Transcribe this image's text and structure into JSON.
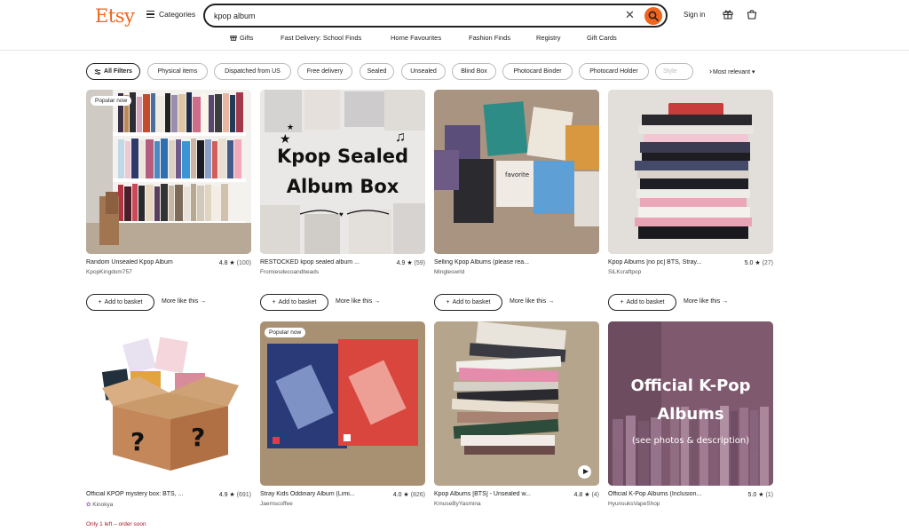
{
  "header": {
    "logo": "Etsy",
    "categories_label": "Categories",
    "search_value": "kpop album",
    "signin_label": "Sign in"
  },
  "subnav": [
    "Gifts",
    "Fast Delivery: School Finds",
    "Home Favourites",
    "Fashion Finds",
    "Registry",
    "Gift Cards"
  ],
  "filters": [
    "All Filters",
    "Physical items",
    "Dispatched from US",
    "Free delivery",
    "Sealed",
    "Unsealed",
    "Blind Box",
    "Photocard Binder",
    "Photocard Holder",
    "Style"
  ],
  "sort_label": "Most relevant",
  "colors": {
    "brand": "#f1641e"
  },
  "card_actions": {
    "basket": "Add to basket",
    "more": "More like this"
  },
  "listings": [
    {
      "badge": "Popular now",
      "title": "Random Unsealed Kpop Album",
      "rating": "4.8",
      "count": "(100)",
      "shop": "KpopKingdom757"
    },
    {
      "badge": "",
      "title": "RESTOCKED kpop sealed album ...",
      "rating": "4.9",
      "count": "(59)",
      "shop": "Fromiesdecoandbeads",
      "image_text": [
        "Kpop Sealed",
        "Album Box"
      ]
    },
    {
      "badge": "",
      "title": "Selling Kpop Albums (please rea...",
      "rating": "",
      "count": "",
      "shop": "Mingleswrld"
    },
    {
      "badge": "",
      "title": "Kpop Albums [no pc] BTS, Stray...",
      "rating": "5.0",
      "count": "(27)",
      "shop": "SiLKcraftpop"
    },
    {
      "badge": "",
      "title": "Official KPOP mystery box: BTS, ...",
      "rating": "4.9",
      "count": "(691)",
      "shop": "Kinokya",
      "stock": "Only 1 left – order soon"
    },
    {
      "badge": "Popular now",
      "title": "Stray Kids Oddinary Album (Limi...",
      "rating": "4.0",
      "count": "(826)",
      "shop": "Jaemscoffee"
    },
    {
      "badge": "",
      "title": "Kpop Albums [BTS] - Unsealed w...",
      "rating": "4.8",
      "count": "(4)",
      "shop": "KmuseByYasmina"
    },
    {
      "badge": "",
      "title": "Official K-Pop Albums (Inclusion...",
      "rating": "5.0",
      "count": "(1)",
      "shop": "HyunsuksVapeShop",
      "image_text": [
        "Official K-Pop",
        "Albums",
        "(see photos & description)"
      ]
    }
  ]
}
